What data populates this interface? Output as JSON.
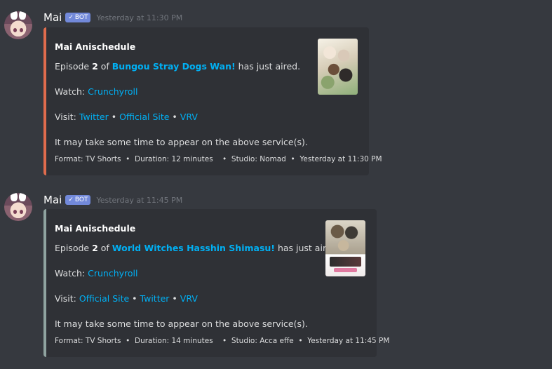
{
  "messages": [
    {
      "username": "Mai",
      "bot_label": "BOT",
      "timestamp": "Yesterday at 11:30 PM",
      "embed": {
        "color": "#e06c4d",
        "author": "Mai Anischedule",
        "ep_prefix": "Episode ",
        "ep_number": "2",
        "ep_of": " of ",
        "anime_title": "Bungou Stray Dogs Wan!",
        "ep_suffix": " has just aired.",
        "watch_label": "Watch: ",
        "watch_links": [
          "Crunchyroll"
        ],
        "visit_label": "Visit: ",
        "visit_links": [
          "Twitter",
          "Official Site",
          "VRV"
        ],
        "separator": " • ",
        "note": "It may take some time to appear on the above service(s).",
        "footer": "Format: TV Shorts  •  Duration: 12 minutes    •  Studio: Nomad  •  Yesterday at 11:30 PM",
        "thumbnail": "anime-poster-bungou-stray-dogs-wan"
      }
    },
    {
      "username": "Mai",
      "bot_label": "BOT",
      "timestamp": "Yesterday at 11:45 PM",
      "embed": {
        "color": "#8fa3a0",
        "author": "Mai Anischedule",
        "ep_prefix": "Episode ",
        "ep_number": "2",
        "ep_of": " of ",
        "anime_title": "World Witches Hasshin Shimasu!",
        "ep_suffix": " has just aired.",
        "watch_label": "Watch: ",
        "watch_links": [
          "Crunchyroll"
        ],
        "visit_label": "Visit: ",
        "visit_links": [
          "Official Site",
          "Twitter",
          "VRV"
        ],
        "separator": " • ",
        "note": "It may take some time to appear on the above service(s).",
        "footer": "Format: TV Shorts  •  Duration: 14 minutes    •  Studio: Acca effe  •  Yesterday at 11:45 PM",
        "thumbnail": "anime-poster-world-witches-hasshin-shimasu"
      }
    }
  ],
  "icons": {
    "bot_check": "checkmark-icon"
  }
}
